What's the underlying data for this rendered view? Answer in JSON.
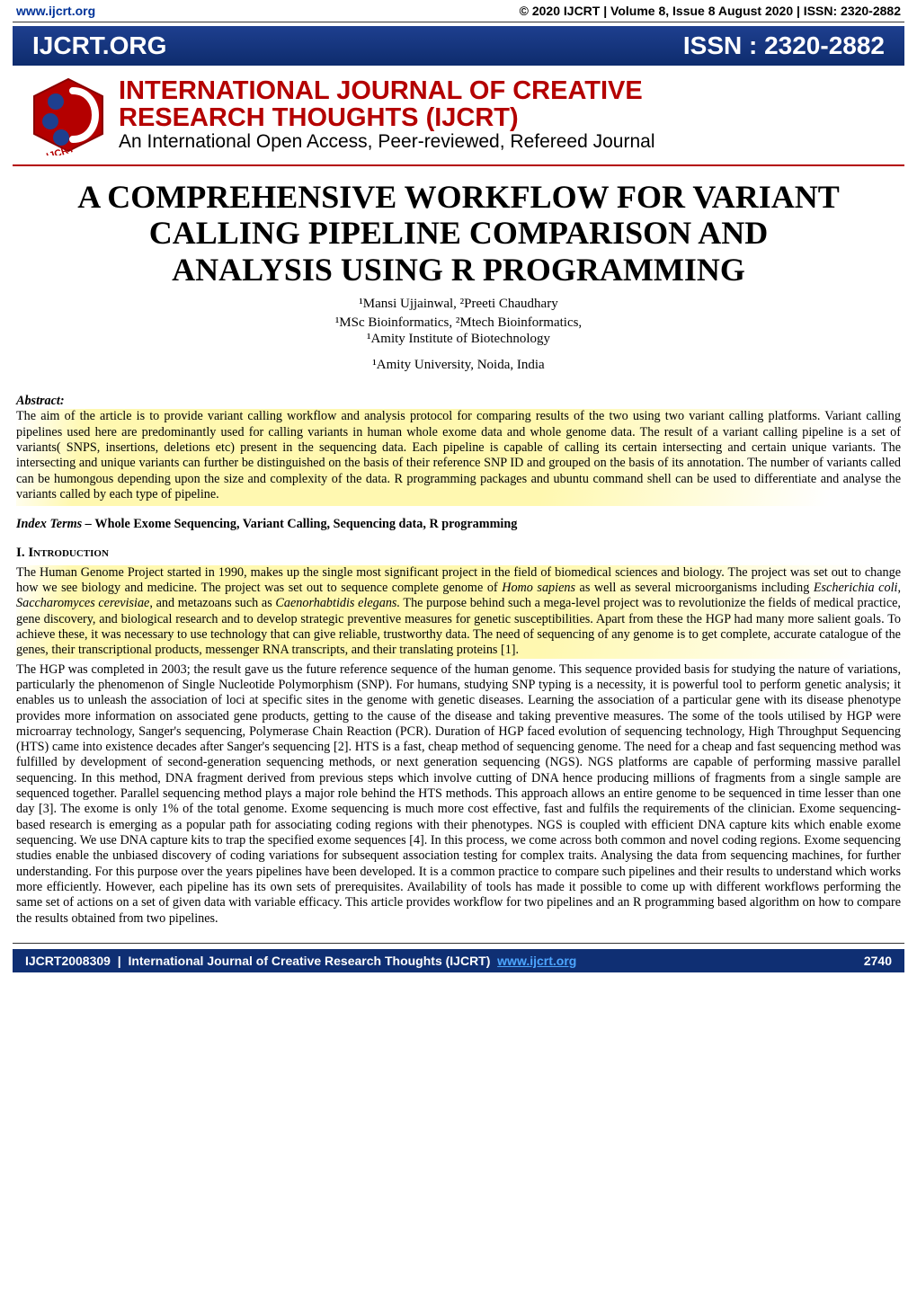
{
  "topbar": {
    "site": "www.ijcrt.org",
    "site_href": "#",
    "issue": "© 2020 IJCRT | Volume 8, Issue 8 August 2020 | ISSN: 2320-2882"
  },
  "banner": {
    "org": "IJCRT.ORG",
    "issn": "ISSN : 2320-2882",
    "journal_title_1": "INTERNATIONAL JOURNAL OF CREATIVE",
    "journal_title_2": "RESEARCH THOUGHTS (IJCRT)",
    "journal_sub": "An International Open Access, Peer-reviewed, Refereed Journal"
  },
  "paper": {
    "title_l1": "A COMPREHENSIVE WORKFLOW FOR VARIANT",
    "title_l2": "CALLING PIPELINE COMPARISON AND",
    "title_l3": "ANALYSIS USING R PROGRAMMING",
    "authors": "¹Mansi Ujjainwal, ²Preeti Chaudhary",
    "affil1": "¹MSc Bioinformatics, ²Mtech Bioinformatics,",
    "affil2": "¹Amity Institute of Biotechnology",
    "affil3": "¹Amity University, Noida, India"
  },
  "abstract": {
    "head": "Abstract:",
    "body": "The aim of the article is to provide variant calling workflow and analysis protocol for comparing results of the two using two variant calling platforms. Variant calling pipelines used here are predominantly used for calling variants in human whole exome data and whole genome data. The result of a variant calling pipeline is a set of variants( SNPS, insertions, deletions etc) present in the sequencing data. Each pipeline is capable of calling its certain intersecting and certain unique variants. The intersecting and unique variants can further be distinguished on the basis of their reference SNP ID and grouped on the basis of its annotation. The number of variants called can be humongous depending upon the size and complexity of the data. R programming packages and ubuntu command shell can be used to differentiate and analyse the variants called by each type of pipeline."
  },
  "index_terms": {
    "prefix": "Index Terms – ",
    "kw": "Whole Exome Sequencing, Variant Calling, Sequencing data, R programming"
  },
  "intro": {
    "num": "I.",
    "head": "Introduction",
    "p1a": "The Human Genome Project started in 1990, makes up the single most significant  project in the field of biomedical sciences and biology. The project was set out to change how we see biology and medicine. The project was set out to sequence complete genome of ",
    "p1it1": "Homo sapiens",
    "p1b": " as well as several microorganisms including ",
    "p1it2": "Escherichia coli",
    "p1c": ", ",
    "p1it3": "Saccharomyces cerevisiae",
    "p1d": ", and metazoans such as ",
    "p1it4": "Caenorhabtidis elegans.",
    "p1e": " The purpose behind such a mega-level project was to revolutionize the fields of medical practice, gene discovery, and biological research and to develop strategic preventive measures for genetic susceptibilities. Apart from these the HGP had many more salient goals. To achieve these, it was necessary to use technology that can give reliable, trustworthy data. The need of sequencing of any genome is to get complete, accurate catalogue of the genes, their transcriptional products, messenger RNA transcripts, and their translating proteins [1].",
    "p2": "The HGP was completed in 2003; the result gave us the future reference sequence of the human genome. This sequence provided basis for studying the nature of variations, particularly the phenomenon of Single Nucleotide Polymorphism (SNP). For humans, studying SNP typing is a necessity, it is powerful tool to perform genetic analysis; it enables us to unleash the association of loci at specific sites in the genome with genetic diseases. Learning the association of a particular gene with its disease phenotype provides more information on associated gene products, getting to the cause of the disease and taking preventive measures. The some of the tools utilised by HGP were microarray technology, Sanger's sequencing, Polymerase Chain Reaction (PCR). Duration of HGP faced evolution of sequencing technology, High Throughput Sequencing (HTS) came into existence decades after Sanger's sequencing [2]. HTS is a fast, cheap method of sequencing genome. The need for a cheap and fast sequencing method was fulfilled by development of second-generation sequencing methods, or next generation sequencing (NGS). NGS platforms are capable of performing massive parallel sequencing. In this method, DNA fragment derived from previous steps which involve cutting of DNA hence producing millions of fragments from a single sample are sequenced together. Parallel sequencing method plays a major role behind the HTS methods. This approach allows an entire genome to be sequenced in time lesser than one day [3]. The exome is only 1% of the total genome. Exome sequencing is much more cost effective, fast and fulfils the requirements of the clinician. Exome sequencing-based research is emerging as a popular path for associating coding regions with their phenotypes. NGS is coupled with efficient DNA capture kits which enable exome sequencing. We use DNA capture kits to trap the specified exome sequences [4].  In this process, we come across both common and novel coding regions. Exome sequencing studies enable the unbiased discovery of coding variations for subsequent association testing for complex traits. Analysing the data from sequencing machines, for further understanding. For this purpose over the years pipelines have been developed. It is a common practice to compare such pipelines and their results to understand which works more efficiently. However, each pipeline has its own sets of prerequisites. Availability of tools has made it possible to come up with different workflows performing the same set of actions on a set of given data with variable efficacy. This article provides workflow for two pipelines and an R programming based algorithm on how to compare the results obtained from two pipelines."
  },
  "footer": {
    "id": "IJCRT2008309",
    "mid": "International Journal of Creative Research Thoughts (IJCRT)",
    "link_text": "www.ijcrt.org",
    "link_href": "#",
    "page": "2740"
  }
}
